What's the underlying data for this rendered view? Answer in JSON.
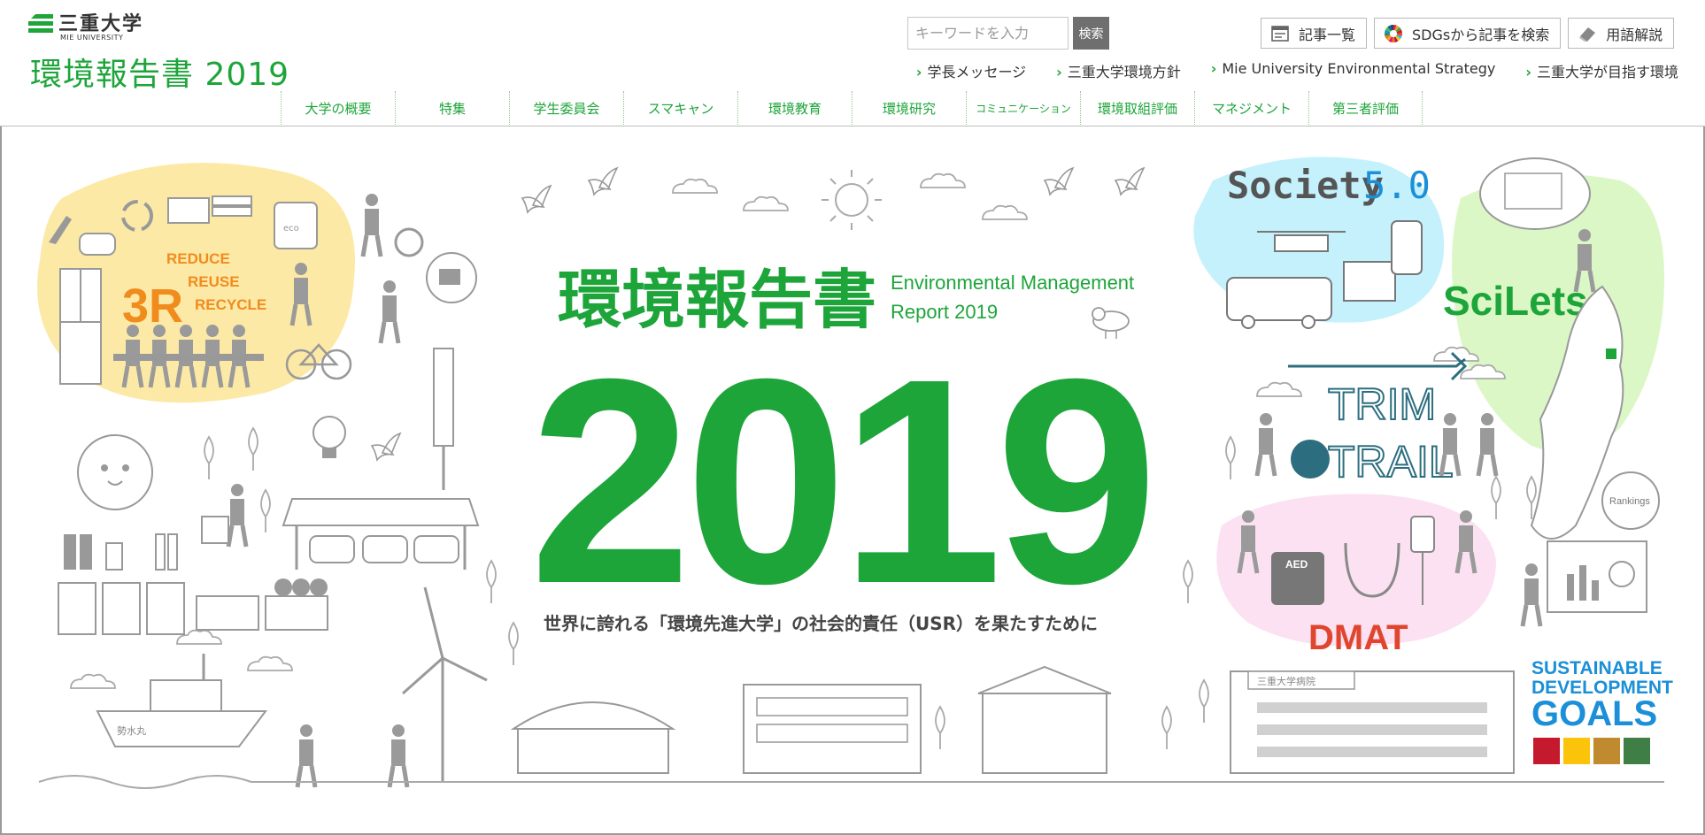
{
  "brand": {
    "name_jp": "三重大学",
    "name_en": "MIE UNIVERSITY",
    "green": "#1da53a"
  },
  "site": {
    "title": "環境報告書 2019"
  },
  "search": {
    "placeholder": "キーワードを入力",
    "button": "検索"
  },
  "toolbar": [
    {
      "label": "記事一覧",
      "icon": "list-icon"
    },
    {
      "label": "SDGsから記事を検索",
      "icon": "sdgs-wheel-icon"
    },
    {
      "label": "用語解説",
      "icon": "eraser-icon"
    }
  ],
  "sublinks": [
    "学長メッセージ",
    "三重大学環境方針",
    "Mie University Environmental Strategy",
    "三重大学が目指す環境"
  ],
  "nav": [
    "大学の概要",
    "特集",
    "学生委員会",
    "スマキャン",
    "環境教育",
    "環境研究",
    "コミュニケーション",
    "環境取組評価",
    "マネジメント",
    "第三者評価"
  ],
  "hero": {
    "title_jp": "環境報告書",
    "title_en_1": "Environmental Management",
    "title_en_2": "Report 2019",
    "year": "2019",
    "tagline": "世界に誇れる「環境先進大学」の社会的責任（USR）を果たすために",
    "threeR_big": "3R",
    "threeR_1": "REDUCE",
    "threeR_2": "REUSE",
    "threeR_3": "RECYCLE",
    "eco_label": "eco",
    "society_label": "Society",
    "society_version": "5.0",
    "scilets": "SciLets",
    "trim": "TRIM",
    "trail": "TRAIL",
    "dmat": "DMAT",
    "aed": "AED",
    "rankings": "Rankings",
    "hospital": "三重大学病院",
    "ship": "勢水丸",
    "sdgs_1": "SUSTAINABLE",
    "sdgs_2": "DEVELOPMENT",
    "sdgs_3": "GOALS",
    "colors": {
      "yellow_blob": "#fde9a6",
      "cyan_blob": "#c4f1fb",
      "green_blob": "#dbf7c6",
      "pink_blob": "#fbe1f1",
      "dmat_red": "#e0452f",
      "sdgs_blue": "#1b8fd7",
      "orange": "#f08c1e"
    }
  }
}
